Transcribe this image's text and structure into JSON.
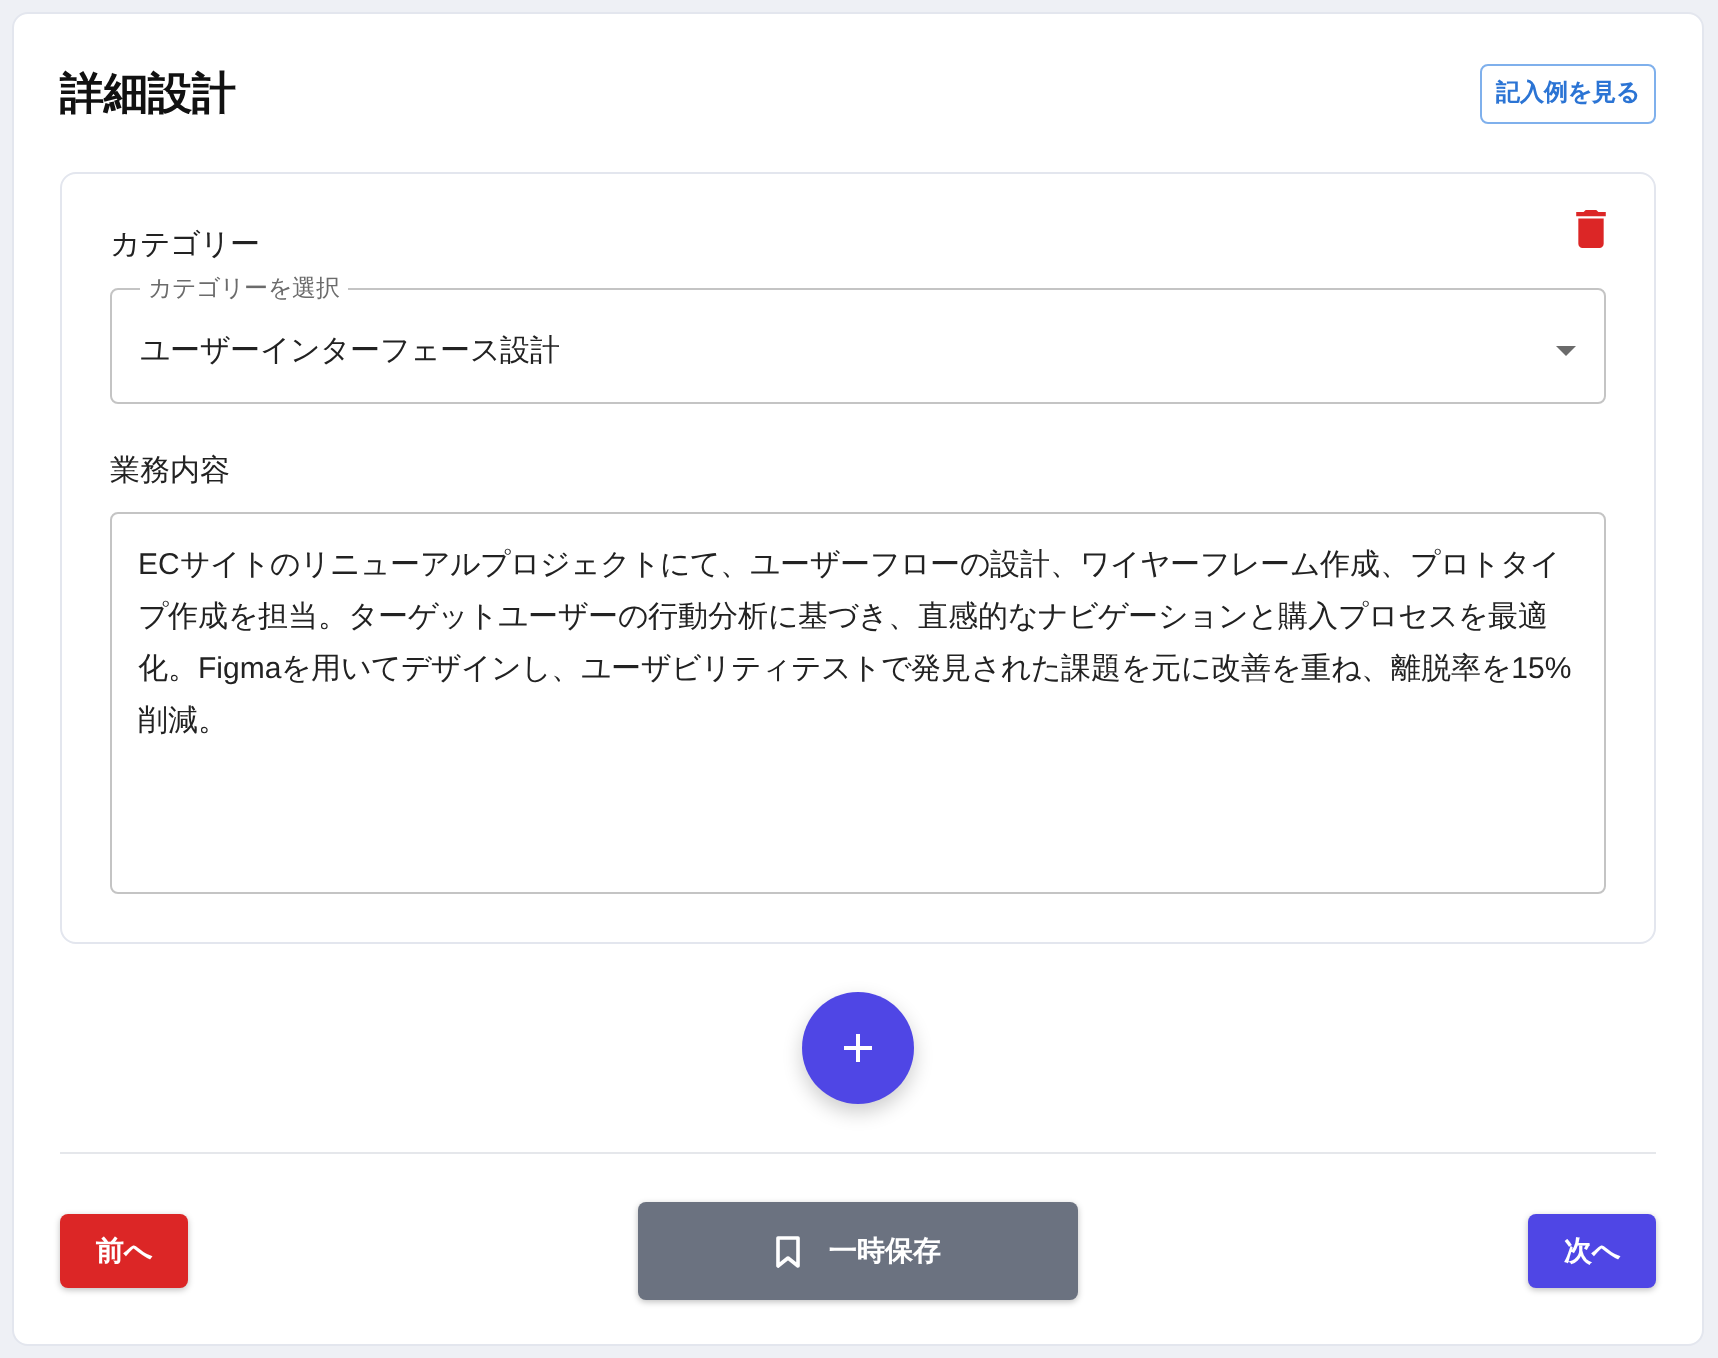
{
  "header": {
    "title": "詳細設計",
    "example_button": "記入例を見る"
  },
  "entries": [
    {
      "category_label": "カテゴリー",
      "category_select": {
        "label": "カテゴリーを選択",
        "value": "ユーザーインターフェース設計"
      },
      "description_label": "業務内容",
      "description": {
        "value": "ECサイトのリニューアルプロジェクトにて、ユーザーフローの設計、ワイヤーフレーム作成、プロトタイプ作成を担当。ターゲットユーザーの行動分析に基づき、直感的なナビゲーションと購入プロセスを最適化。Figmaを用いてデザインし、ユーザビリティテストで発見された課題を元に改善を重ね、離脱率を15%削減。"
      }
    }
  ],
  "footer": {
    "buttons": [
      {
        "kind": "back",
        "label": "前へ"
      },
      {
        "kind": "save",
        "label": "一時保存"
      },
      {
        "kind": "next",
        "label": "次へ"
      }
    ]
  }
}
